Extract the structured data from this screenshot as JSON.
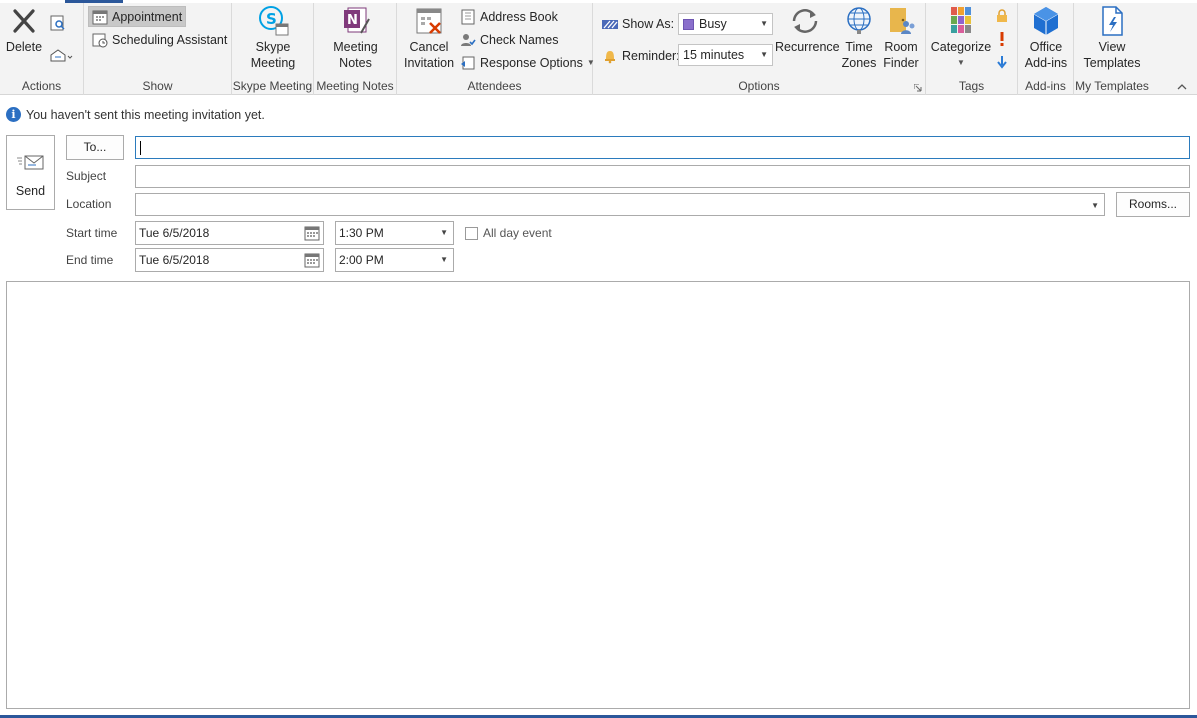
{
  "ribbon": {
    "actions": {
      "label": "Actions",
      "delete": "Delete"
    },
    "show": {
      "label": "Show",
      "appointment": "Appointment",
      "scheduling": "Scheduling Assistant"
    },
    "skype": {
      "label": "Skype Meeting",
      "button_line1": "Skype",
      "button_line2": "Meeting"
    },
    "notes": {
      "label": "Meeting Notes",
      "button_line1": "Meeting",
      "button_line2": "Notes"
    },
    "attendees": {
      "label": "Attendees",
      "cancel_line1": "Cancel",
      "cancel_line2": "Invitation",
      "address_book": "Address Book",
      "check_names": "Check Names",
      "response_options": "Response Options"
    },
    "options": {
      "label": "Options",
      "show_as_label": "Show As:",
      "show_as_value": "Busy",
      "reminder_label": "Reminder:",
      "reminder_value": "15 minutes",
      "recurrence": "Recurrence",
      "time_zones_line1": "Time",
      "time_zones_line2": "Zones",
      "room_finder_line1": "Room",
      "room_finder_line2": "Finder"
    },
    "tags": {
      "label": "Tags",
      "categorize": "Categorize"
    },
    "addins": {
      "label": "Add-ins",
      "office_line1": "Office",
      "office_line2": "Add-ins"
    },
    "templates": {
      "label": "My Templates",
      "view_line1": "View",
      "view_line2": "Templates"
    }
  },
  "infobar": {
    "message": "You haven't sent this meeting invitation yet."
  },
  "form": {
    "send": "Send",
    "to_button": "To...",
    "to_value": "",
    "subject_label": "Subject",
    "subject_value": "",
    "location_label": "Location",
    "location_value": "",
    "rooms_button": "Rooms...",
    "start_label": "Start time",
    "start_date": "Tue 6/5/2018",
    "start_time": "1:30 PM",
    "end_label": "End time",
    "end_date": "Tue 6/5/2018",
    "end_time": "2:00 PM",
    "all_day_label": "All day event",
    "all_day_checked": false
  },
  "colors": {
    "accent": "#2b579a",
    "busy": "#8a6fcc",
    "importance_high": "#d83b01",
    "importance_low": "#2b7bd6"
  }
}
